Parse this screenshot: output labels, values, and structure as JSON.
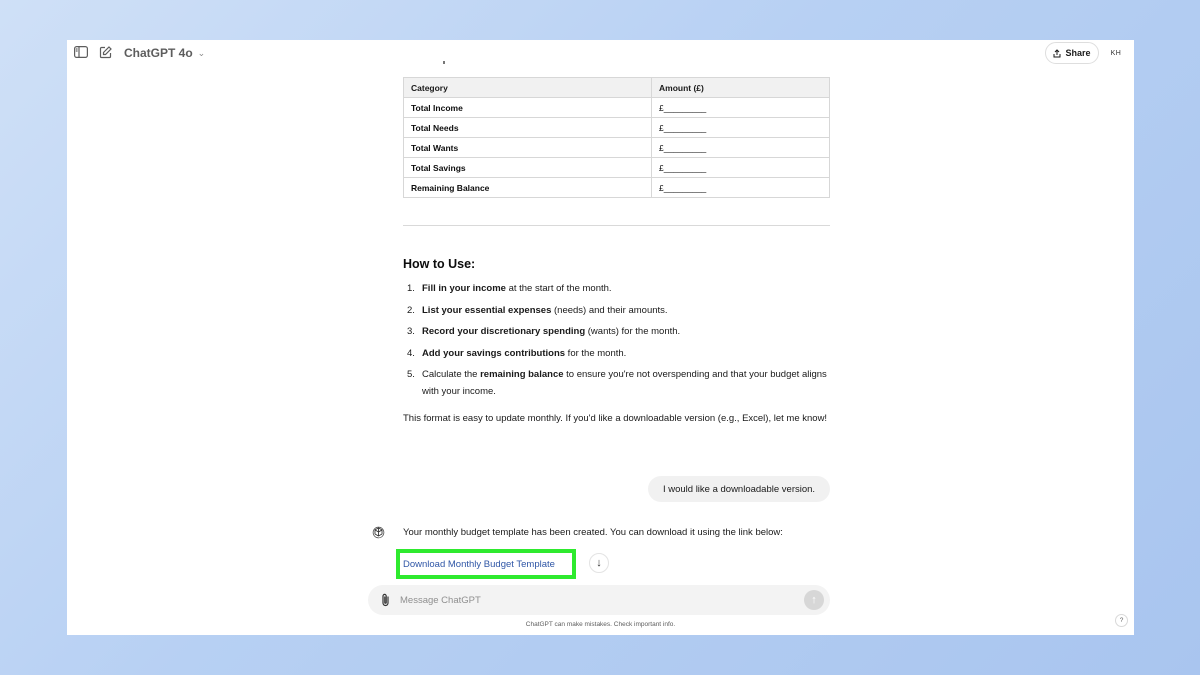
{
  "header": {
    "model_name": "ChatGPT 4o",
    "share_label": "Share",
    "avatar_initials": "KH"
  },
  "budget_table": {
    "headers": [
      "Category",
      "Amount (£)"
    ],
    "rows": [
      [
        "Total Income",
        "£_________"
      ],
      [
        "Total Needs",
        "£_________"
      ],
      [
        "Total Wants",
        "£_________"
      ],
      [
        "Total Savings",
        "£_________"
      ],
      [
        "Remaining Balance",
        "£_________"
      ]
    ]
  },
  "how_to": {
    "heading": "How to Use:",
    "steps": [
      {
        "num": "1.",
        "bold": "Fill in your income",
        "rest": " at the start of the month."
      },
      {
        "num": "2.",
        "bold": "List your essential expenses",
        "rest": " (needs) and their amounts."
      },
      {
        "num": "3.",
        "bold": "Record your discretionary spending",
        "rest": " (wants) for the month."
      },
      {
        "num": "4.",
        "bold": "Add your savings contributions",
        "rest": " for the month."
      },
      {
        "num": "5.",
        "pre": "Calculate the ",
        "bold": "remaining balance",
        "rest": " to ensure you're not overspending and that your budget aligns with your income."
      }
    ],
    "closing": "This format is easy to update monthly. If you'd like a downloadable version (e.g., Excel), let me know!"
  },
  "user_message": "I would like a downloadable version.",
  "assistant_reply": "Your monthly budget template has been created. You can download it using the link below:",
  "download_link_label": "Download Monthly Budget Template",
  "composer": {
    "placeholder": "Message ChatGPT"
  },
  "disclaimer": "ChatGPT can make mistakes. Check important info.",
  "help_label": "?",
  "colors": {
    "link": "#2f56a6",
    "highlight_box": "#2eea2e",
    "desktop_bg": "#b7d0f3"
  }
}
